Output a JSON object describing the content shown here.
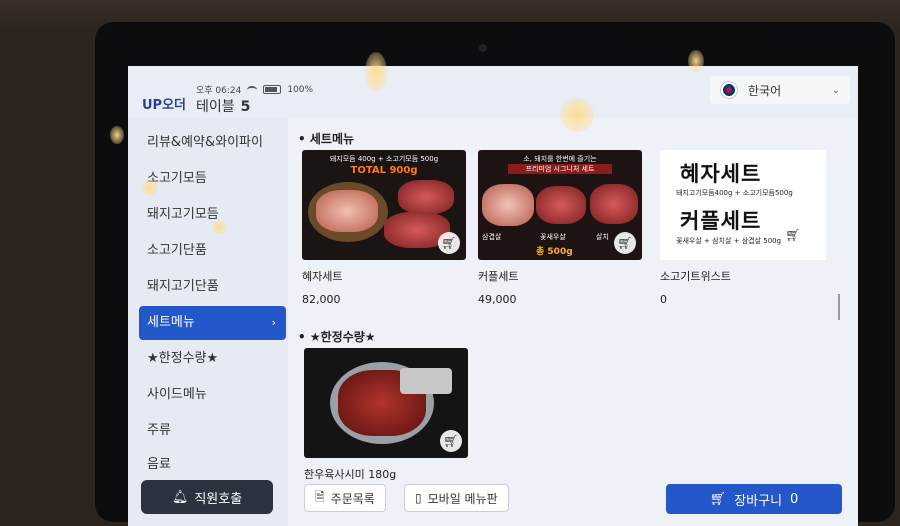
{
  "header": {
    "logo": "UP오더",
    "time": "오후 06:24",
    "battery": "100%",
    "table_label": "테이블",
    "table_number": "5",
    "language": "한국어"
  },
  "sidebar": {
    "items": [
      {
        "label": "리뷰&예약&와이파이"
      },
      {
        "label": "소고기모듬"
      },
      {
        "label": "돼지고기모듬"
      },
      {
        "label": "소고기단품"
      },
      {
        "label": "돼지고기단품"
      },
      {
        "label": "세트메뉴",
        "active": true
      },
      {
        "label": "★한정수량★"
      },
      {
        "label": "사이드메뉴"
      },
      {
        "label": "주류"
      },
      {
        "label": "음료"
      }
    ],
    "staff_call": "직원호출"
  },
  "sections": {
    "set_menu": {
      "title": "세트메뉴",
      "items": [
        {
          "name": "혜자세트",
          "price": "82,000",
          "thumb_top": "돼지모듬 400g + 소고기모듬 500g",
          "thumb_total": "TOTAL 900g"
        },
        {
          "name": "커플세트",
          "price": "49,000",
          "thumb_top1": "소, 돼지를 한번에 즐기는",
          "thumb_top2": "프리미엄 시그니처 세트",
          "thumb_labels": [
            "삼겹살",
            "꽃새우살",
            "살치"
          ],
          "thumb_weight": "총 500g"
        },
        {
          "name": "소고기트위스트",
          "price": "0",
          "thumb_title1": "혜자세트",
          "thumb_sub1": "돼지고기모듬400g + 소고기모듬500g",
          "thumb_title2": "커플세트",
          "thumb_sub2": "꽃새우살 + 삼치살 + 삼겹살 500g"
        }
      ]
    },
    "limited": {
      "title": "★한정수량★",
      "items": [
        {
          "name": "한우육사시미 180g"
        }
      ]
    }
  },
  "bottom": {
    "order_list": "주문목록",
    "mobile_menu": "모바일 메뉴판",
    "cart_label": "장바구니",
    "cart_count": "0"
  },
  "colors": {
    "accent": "#2457c9",
    "sidebar_bg": "#e6eaf3",
    "staff_button": "#2c3340"
  }
}
